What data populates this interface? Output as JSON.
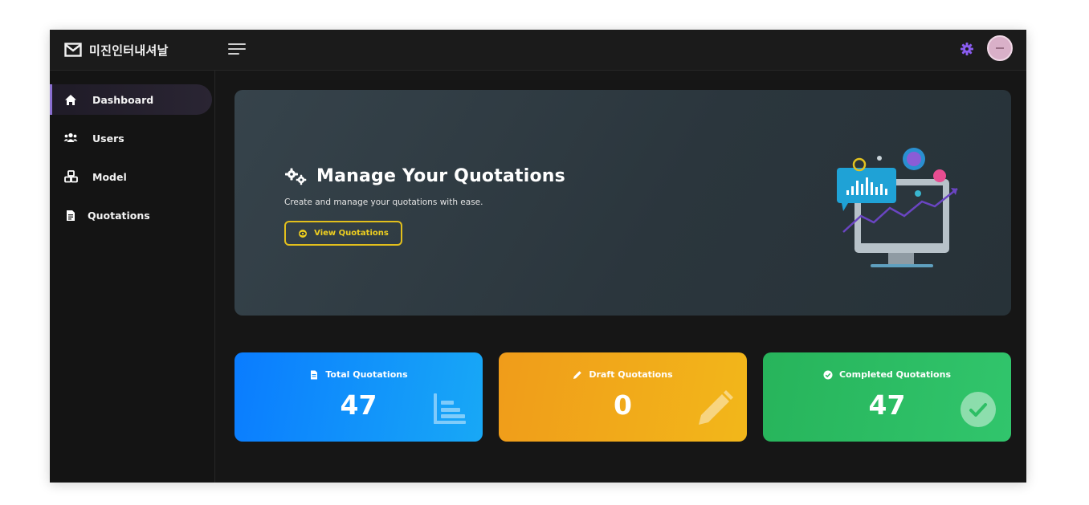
{
  "header": {
    "brand_name": "미진인터내셔날",
    "icons": {
      "brand": "mail-icon",
      "menu": "hamburger-menu-icon",
      "settings": "gear-icon",
      "avatar": "user-avatar-icon"
    }
  },
  "sidebar": {
    "items": [
      {
        "label": "Dashboard",
        "icon": "home-icon",
        "active": true
      },
      {
        "label": "Users",
        "icon": "users-icon",
        "active": false
      },
      {
        "label": "Model",
        "icon": "cubes-icon",
        "active": false
      },
      {
        "label": "Quotations",
        "icon": "file-icon",
        "active": false
      }
    ]
  },
  "hero": {
    "title": "Manage Your Quotations",
    "subtitle": "Create and manage your quotations with ease.",
    "button_label": "View Quotations",
    "icons": {
      "title": "gears-icon",
      "button": "eye-icon",
      "illustration": "analytics-monitor-illustration"
    }
  },
  "stats": [
    {
      "title": "Total Quotations",
      "value": "47",
      "icon": "file-icon",
      "deco": "bar-chart-icon",
      "color": "#0a7cff"
    },
    {
      "title": "Draft Quotations",
      "value": "0",
      "icon": "pencil-icon",
      "deco": "pencil-icon",
      "color": "#f09c1a"
    },
    {
      "title": "Completed Quotations",
      "value": "47",
      "icon": "check-circle-icon",
      "deco": "check-circle-icon",
      "color": "#27b45b"
    }
  ],
  "colors": {
    "accent": "#8a6fd0",
    "button_outline": "#e2bf1c",
    "background": "#161616"
  }
}
